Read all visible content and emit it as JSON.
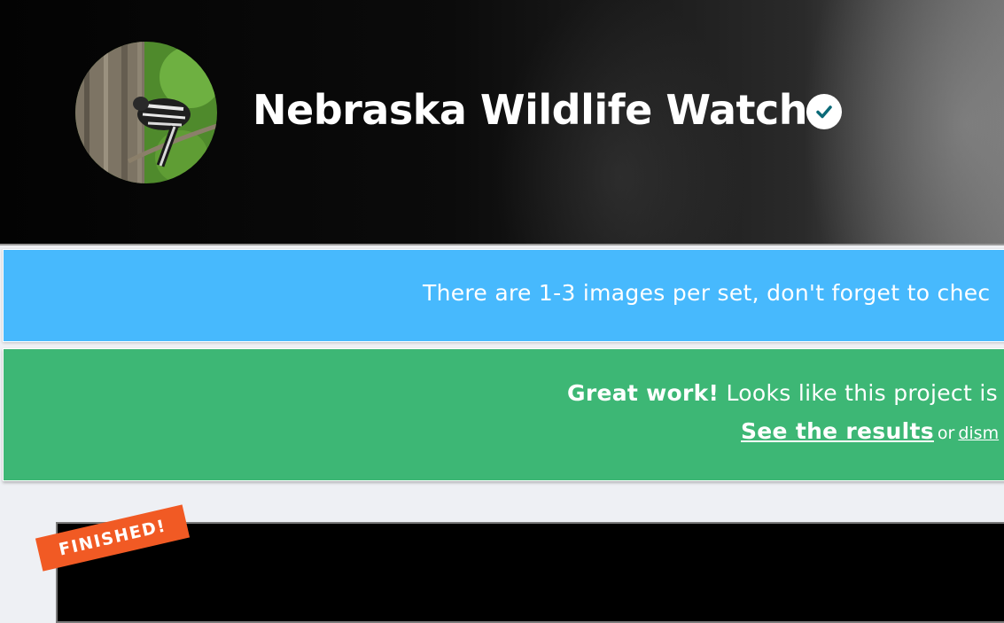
{
  "project": {
    "title": "Nebraska Wildlife Watch",
    "verified_icon": "check-circle-icon"
  },
  "banners": {
    "info_text": "There are 1-3 images per set, don't forget to chec",
    "complete_bold": "Great work!",
    "complete_text": " Looks like this project is",
    "see_results": "See the results",
    "or": "or",
    "dismiss": "dism"
  },
  "card": {
    "badge": "FINISHED!"
  },
  "colors": {
    "info_banner": "#47b9fd",
    "success_banner": "#3db775",
    "badge": "#f15a24",
    "verified_check": "#0b6a78"
  }
}
